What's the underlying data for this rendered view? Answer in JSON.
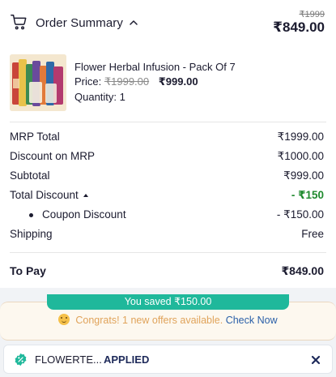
{
  "header": {
    "title": "Order Summary",
    "strike_total": "₹1999",
    "total": "₹849.00"
  },
  "product": {
    "name": "Flower Herbal Infusion - Pack Of 7",
    "price_label": "Price:",
    "mrp": "₹1999.00",
    "price": "₹999.00",
    "quantity": "Quantity: 1"
  },
  "summary": {
    "rows": [
      {
        "label": "MRP Total",
        "value": "₹1999.00"
      },
      {
        "label": "Discount on MRP",
        "value": "₹1000.00"
      },
      {
        "label": "Subtotal",
        "value": "₹999.00"
      },
      {
        "label": "Total Discount",
        "value": "- ₹150"
      },
      {
        "label": "Coupon Discount",
        "value": "- ₹150.00"
      },
      {
        "label": "Shipping",
        "value": "Free"
      }
    ],
    "to_pay_label": "To Pay",
    "to_pay_value": "₹849.00"
  },
  "offers": {
    "saved_text": "You saved ₹150.00",
    "congrats_text": "Congrats! 1 new offers available.",
    "check_now": "Check Now"
  },
  "coupon": {
    "code": "FLOWERTE...",
    "status": "APPLIED"
  },
  "colors": {
    "accent_green": "#1fb89b",
    "discount_green": "#1f8a2e",
    "link_blue": "#2a5fa8"
  },
  "icons": [
    "cart-icon",
    "chevron-up-icon",
    "caret-up-icon",
    "emoji-icon",
    "coupon-badge-icon",
    "close-icon"
  ]
}
